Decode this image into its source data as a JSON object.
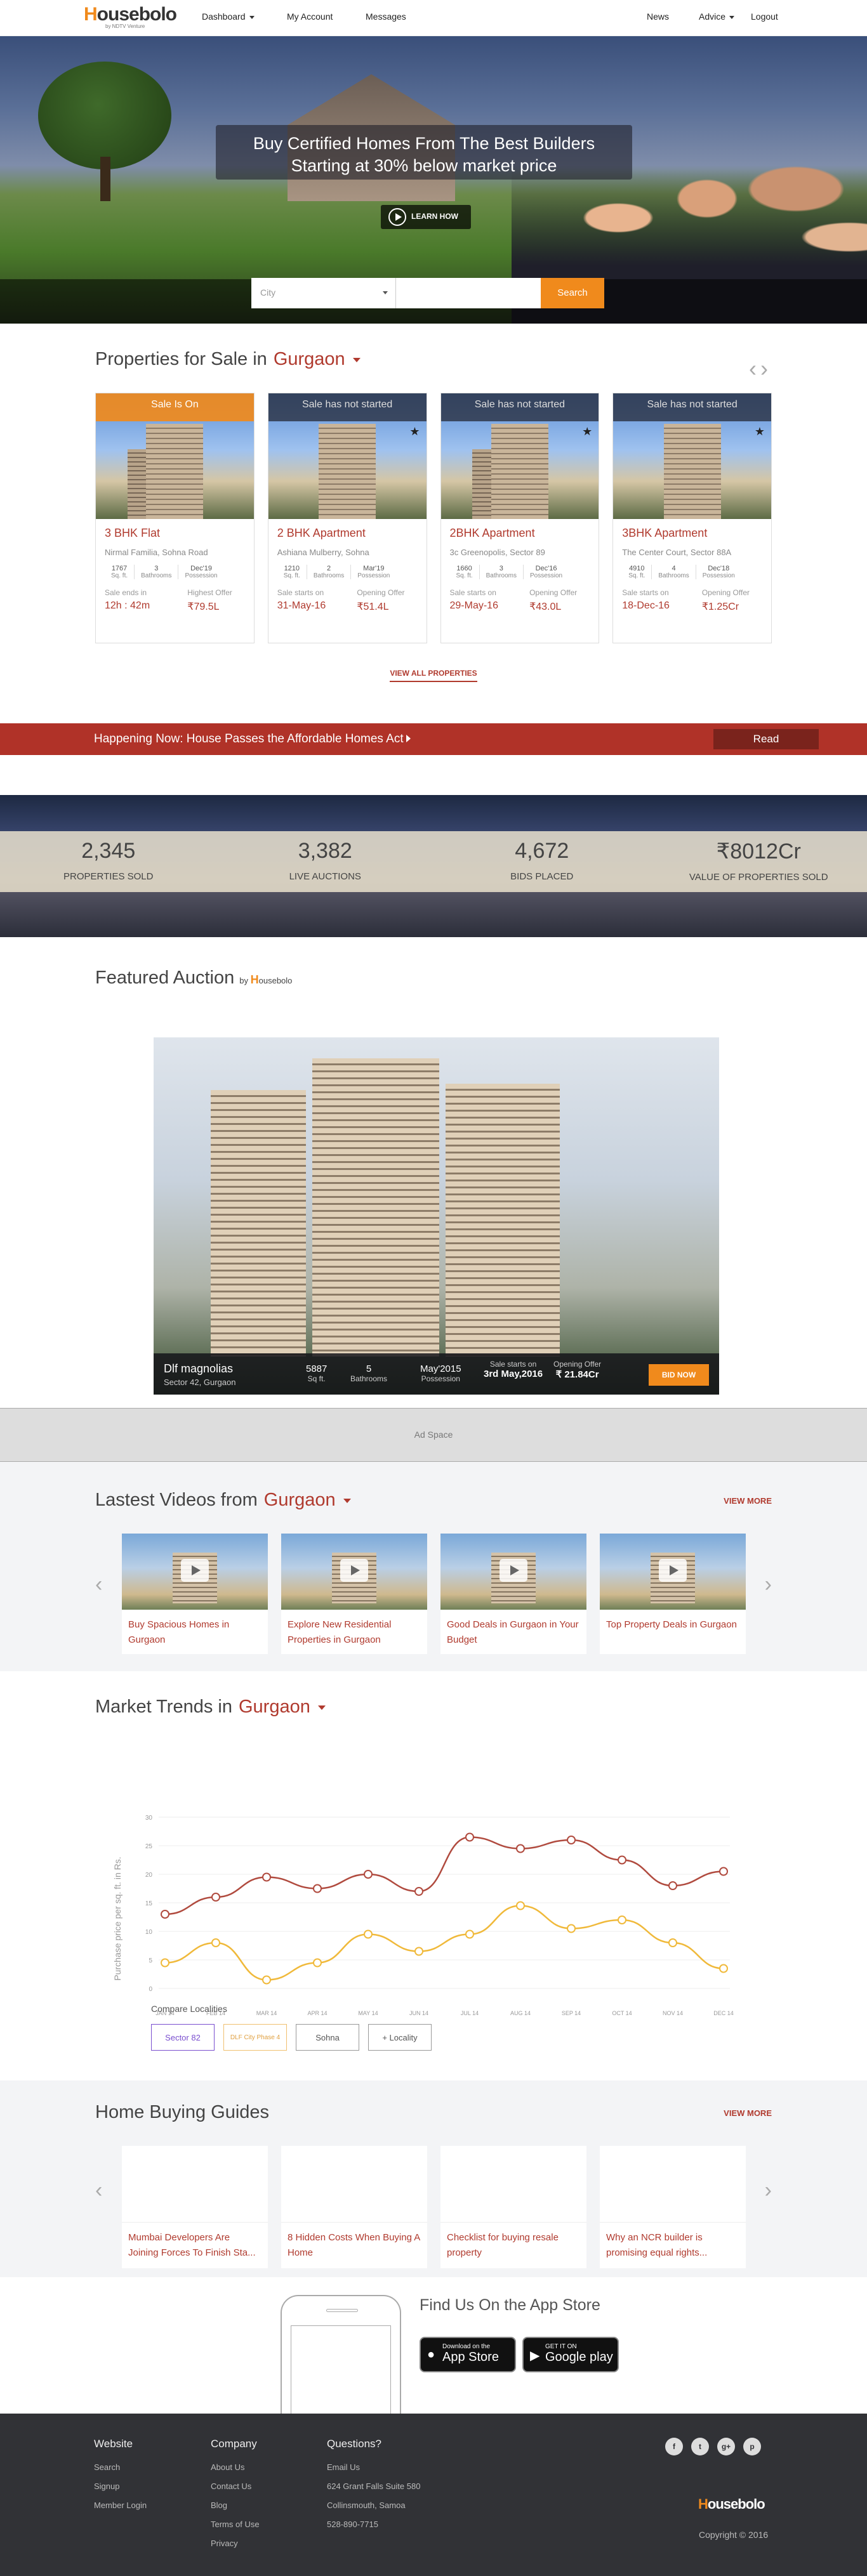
{
  "header": {
    "logo_first": "H",
    "logo_rest": "ousebolo",
    "logo_sub": "by NDTV Venture",
    "nav_left": [
      "Dashboard",
      "My Account",
      "Messages"
    ],
    "nav_right": [
      "News",
      "Advice",
      "Logout"
    ]
  },
  "hero": {
    "line1": "Buy Certified Homes From The Best Builders",
    "line2": "Starting at 30% below market price",
    "learn_label": "LEARN HOW",
    "city_placeholder": "City",
    "search_label": "Search"
  },
  "properties": {
    "title": "Properties for Sale in",
    "city": "Gurgaon",
    "view_all": "VIEW ALL PROPERTIES",
    "items": [
      {
        "status": "Sale Is On",
        "name": "3 BHK Flat",
        "location": "Nirmal Familia, Sohna Road",
        "area": "1767",
        "area_unit": "Sq. ft.",
        "baths": "3",
        "baths_label": "Bathrooms",
        "possession": "Dec'19",
        "possession_label": "Possession",
        "l1": "Sale ends in",
        "v1": "12h : 42m",
        "l2": "Highest Offer",
        "v2": "₹79.5L"
      },
      {
        "status": "Sale has not started",
        "name": "2 BHK Apartment",
        "location": "Ashiana Mulberry, Sohna",
        "area": "1210",
        "area_unit": "Sq. ft.",
        "baths": "2",
        "baths_label": "Bathrooms",
        "possession": "Mar'19",
        "possession_label": "Possession",
        "l1": "Sale starts on",
        "v1": "31-May-16",
        "l2": "Opening Offer",
        "v2": "₹51.4L"
      },
      {
        "status": "Sale has not started",
        "name": "2BHK Apartment",
        "location": "3c Greenopolis, Sector 89",
        "area": "1660",
        "area_unit": "Sq. ft.",
        "baths": "3",
        "baths_label": "Bathrooms",
        "possession": "Dec'16",
        "possession_label": "Possession",
        "l1": "Sale starts on",
        "v1": "29-May-16",
        "l2": "Opening Offer",
        "v2": "₹43.0L"
      },
      {
        "status": "Sale has not started",
        "name": "3BHK Apartment",
        "location": "The Center Court, Sector 88A",
        "area": "4910",
        "area_unit": "Sq. ft.",
        "baths": "4",
        "baths_label": "Bathrooms",
        "possession": "Dec'18",
        "possession_label": "Possession",
        "l1": "Sale starts on",
        "v1": "18-Dec-16",
        "l2": "Opening Offer",
        "v2": "₹1.25Cr"
      }
    ]
  },
  "news": {
    "text": "Happening Now: House Passes the Affordable Homes Act",
    "read": "Read"
  },
  "stats": [
    {
      "value": "2,345",
      "label": "PROPERTIES SOLD"
    },
    {
      "value": "3,382",
      "label": "LIVE AUCTIONS"
    },
    {
      "value": "4,672",
      "label": "BIDS PLACED"
    },
    {
      "value": "₹8012Cr",
      "label": "VALUE OF PROPERTIES SOLD"
    }
  ],
  "featured": {
    "title": "Featured Auction",
    "by": "by",
    "name": "Dlf magnolias",
    "location": "Sector 42, Gurgaon",
    "area": "5887",
    "area_unit": "Sq ft.",
    "baths": "5",
    "baths_label": "Bathrooms",
    "possession": "May'2015",
    "possession_label": "Possession",
    "start_label": "Sale starts on",
    "start": "3rd May,2016",
    "offer_label": "Opening Offer",
    "offer": "₹ 21.84Cr",
    "bid": "BID NOW"
  },
  "ad": "Ad Space",
  "videos": {
    "title": "Lastest Videos from",
    "city": "Gurgaon",
    "more": "VIEW MORE",
    "items": [
      "Buy Spacious Homes in Gurgaon",
      "Explore New Residential Properties in Gurgaon",
      "Good Deals in Gurgaon in Your Budget",
      "Top Property Deals in Gurgaon"
    ]
  },
  "market": {
    "title": "Market Trends in",
    "city": "Gurgaon",
    "compare": "Compare Localities",
    "chips": [
      "Sector 82",
      "DLF City Phase 4",
      "Sohna",
      "+ Locality"
    ]
  },
  "chart_data": {
    "type": "line",
    "categories": [
      "JAN 14",
      "FEB 14",
      "MAR 14",
      "APR 14",
      "MAY 14",
      "JUN 14",
      "JUL 14",
      "AUG 14",
      "SEP 14",
      "OCT 14",
      "NOV 14",
      "DEC 14"
    ],
    "series": [
      {
        "values": [
          13,
          16,
          19.5,
          17.5,
          20,
          17,
          26.5,
          24.5,
          26,
          22.5,
          18,
          20.5
        ],
        "color": "#b04a3e"
      },
      {
        "values": [
          4.5,
          8,
          1.5,
          4.5,
          9.5,
          6.5,
          9.5,
          14.5,
          10.5,
          12,
          8,
          3.5
        ],
        "color": "#f0b93a"
      }
    ],
    "ylabel": "Purchase price per sq. ft. in Rs.",
    "ylim": [
      0,
      30
    ],
    "yticks": [
      "0",
      "5",
      "10",
      "15",
      "20",
      "25",
      "30"
    ],
    "grid": true
  },
  "guides": {
    "title": "Home Buying Guides",
    "more": "VIEW MORE",
    "items": [
      "Mumbai Developers Are Joining Forces To Finish Sta...",
      "8 Hidden Costs When Buying A Home",
      "Checklist for buying resale property",
      "Why an NCR builder is promising equal rights..."
    ]
  },
  "app": {
    "title": "Find Us On the App Store",
    "apple_small": "Download on the",
    "apple_big": "App Store",
    "google_small": "GET IT ON",
    "google_big": "Google play"
  },
  "footer": {
    "website": {
      "title": "Website",
      "links": [
        "Search",
        "Signup",
        "Member Login"
      ]
    },
    "company": {
      "title": "Company",
      "links": [
        "About Us",
        "Contact Us",
        "Blog",
        "Terms of Use",
        "Privacy"
      ]
    },
    "questions": {
      "title": "Questions?",
      "lines": [
        "Email Us",
        "624 Grant Falls Suite 580",
        "Collinsmouth, Samoa",
        "528-890-7715"
      ]
    },
    "social": [
      "f",
      "t",
      "g+",
      "p"
    ],
    "copyright": "Copyright © 2016"
  }
}
